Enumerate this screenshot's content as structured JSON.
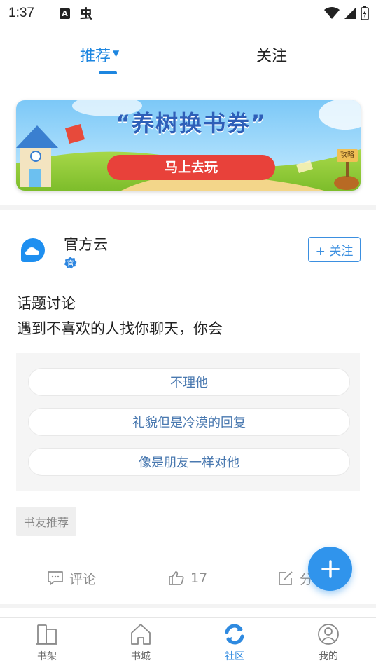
{
  "status_bar": {
    "time": "1:37",
    "notif_a": "A",
    "notif_bug": "虫"
  },
  "top_tabs": {
    "recommend": "推荐",
    "follow": "关注"
  },
  "banner": {
    "title": "“养树换书券”",
    "button": "马上去玩",
    "sign": "攻略"
  },
  "post": {
    "author": "官方云",
    "badge": "官",
    "follow_button": "+ 关注",
    "topic": "话题讨论",
    "question": "遇到不喜欢的人找你聊天，你会",
    "options": [
      "不理他",
      "礼貌但是冷漠的回复",
      "像是朋友一样对他"
    ],
    "tag": "书友推荐",
    "actions": {
      "comment": "评论",
      "like_count": "17",
      "share": "分"
    }
  },
  "bottom_nav": {
    "items": [
      {
        "label": "书架",
        "icon": "bookshelf-icon"
      },
      {
        "label": "书城",
        "icon": "bookstore-icon"
      },
      {
        "label": "社区",
        "icon": "community-icon",
        "active": true
      },
      {
        "label": "我的",
        "icon": "profile-icon"
      }
    ]
  },
  "colors": {
    "accent": "#1d86e0",
    "fab": "#3094ec",
    "option_text": "#4a79b0"
  }
}
